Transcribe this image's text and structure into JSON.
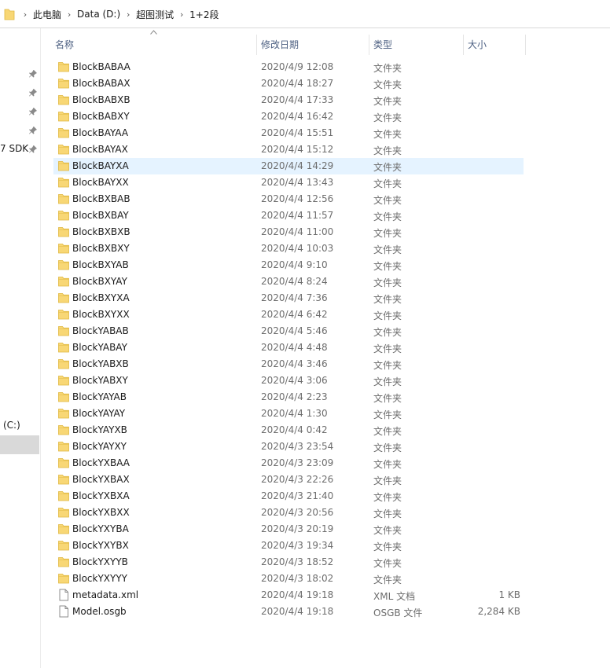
{
  "breadcrumb": [
    "此电脑",
    "Data (D:)",
    "超图测试",
    "1+2段"
  ],
  "nav": {
    "sdk_label": "7 SDK",
    "drive_label": "(C:)"
  },
  "columns": {
    "name": "名称",
    "date": "修改日期",
    "type": "类型",
    "size": "大小"
  },
  "selected_index": 6,
  "colors": {
    "folder": "#f8d775",
    "folder_dark": "#e0b840",
    "selection": "#e5f3ff",
    "header_text": "#4d6082"
  },
  "files": [
    {
      "name": "BlockBABAA",
      "date": "2020/4/9 12:08",
      "type": "文件夹",
      "size": "",
      "kind": "folder"
    },
    {
      "name": "BlockBABAX",
      "date": "2020/4/4 18:27",
      "type": "文件夹",
      "size": "",
      "kind": "folder"
    },
    {
      "name": "BlockBABXB",
      "date": "2020/4/4 17:33",
      "type": "文件夹",
      "size": "",
      "kind": "folder"
    },
    {
      "name": "BlockBABXY",
      "date": "2020/4/4 16:42",
      "type": "文件夹",
      "size": "",
      "kind": "folder"
    },
    {
      "name": "BlockBAYAA",
      "date": "2020/4/4 15:51",
      "type": "文件夹",
      "size": "",
      "kind": "folder"
    },
    {
      "name": "BlockBAYAX",
      "date": "2020/4/4 15:12",
      "type": "文件夹",
      "size": "",
      "kind": "folder"
    },
    {
      "name": "BlockBAYXA",
      "date": "2020/4/4 14:29",
      "type": "文件夹",
      "size": "",
      "kind": "folder"
    },
    {
      "name": "BlockBAYXX",
      "date": "2020/4/4 13:43",
      "type": "文件夹",
      "size": "",
      "kind": "folder"
    },
    {
      "name": "BlockBXBAB",
      "date": "2020/4/4 12:56",
      "type": "文件夹",
      "size": "",
      "kind": "folder"
    },
    {
      "name": "BlockBXBAY",
      "date": "2020/4/4 11:57",
      "type": "文件夹",
      "size": "",
      "kind": "folder"
    },
    {
      "name": "BlockBXBXB",
      "date": "2020/4/4 11:00",
      "type": "文件夹",
      "size": "",
      "kind": "folder"
    },
    {
      "name": "BlockBXBXY",
      "date": "2020/4/4 10:03",
      "type": "文件夹",
      "size": "",
      "kind": "folder"
    },
    {
      "name": "BlockBXYAB",
      "date": "2020/4/4 9:10",
      "type": "文件夹",
      "size": "",
      "kind": "folder"
    },
    {
      "name": "BlockBXYAY",
      "date": "2020/4/4 8:24",
      "type": "文件夹",
      "size": "",
      "kind": "folder"
    },
    {
      "name": "BlockBXYXA",
      "date": "2020/4/4 7:36",
      "type": "文件夹",
      "size": "",
      "kind": "folder"
    },
    {
      "name": "BlockBXYXX",
      "date": "2020/4/4 6:42",
      "type": "文件夹",
      "size": "",
      "kind": "folder"
    },
    {
      "name": "BlockYABAB",
      "date": "2020/4/4 5:46",
      "type": "文件夹",
      "size": "",
      "kind": "folder"
    },
    {
      "name": "BlockYABAY",
      "date": "2020/4/4 4:48",
      "type": "文件夹",
      "size": "",
      "kind": "folder"
    },
    {
      "name": "BlockYABXB",
      "date": "2020/4/4 3:46",
      "type": "文件夹",
      "size": "",
      "kind": "folder"
    },
    {
      "name": "BlockYABXY",
      "date": "2020/4/4 3:06",
      "type": "文件夹",
      "size": "",
      "kind": "folder"
    },
    {
      "name": "BlockYAYAB",
      "date": "2020/4/4 2:23",
      "type": "文件夹",
      "size": "",
      "kind": "folder"
    },
    {
      "name": "BlockYAYAY",
      "date": "2020/4/4 1:30",
      "type": "文件夹",
      "size": "",
      "kind": "folder"
    },
    {
      "name": "BlockYAYXB",
      "date": "2020/4/4 0:42",
      "type": "文件夹",
      "size": "",
      "kind": "folder"
    },
    {
      "name": "BlockYAYXY",
      "date": "2020/4/3 23:54",
      "type": "文件夹",
      "size": "",
      "kind": "folder"
    },
    {
      "name": "BlockYXBAA",
      "date": "2020/4/3 23:09",
      "type": "文件夹",
      "size": "",
      "kind": "folder"
    },
    {
      "name": "BlockYXBAX",
      "date": "2020/4/3 22:26",
      "type": "文件夹",
      "size": "",
      "kind": "folder"
    },
    {
      "name": "BlockYXBXA",
      "date": "2020/4/3 21:40",
      "type": "文件夹",
      "size": "",
      "kind": "folder"
    },
    {
      "name": "BlockYXBXX",
      "date": "2020/4/3 20:56",
      "type": "文件夹",
      "size": "",
      "kind": "folder"
    },
    {
      "name": "BlockYXYBA",
      "date": "2020/4/3 20:19",
      "type": "文件夹",
      "size": "",
      "kind": "folder"
    },
    {
      "name": "BlockYXYBX",
      "date": "2020/4/3 19:34",
      "type": "文件夹",
      "size": "",
      "kind": "folder"
    },
    {
      "name": "BlockYXYYB",
      "date": "2020/4/3 18:52",
      "type": "文件夹",
      "size": "",
      "kind": "folder"
    },
    {
      "name": "BlockYXYYY",
      "date": "2020/4/3 18:02",
      "type": "文件夹",
      "size": "",
      "kind": "folder"
    },
    {
      "name": "metadata.xml",
      "date": "2020/4/4 19:18",
      "type": "XML 文档",
      "size": "1 KB",
      "kind": "file"
    },
    {
      "name": "Model.osgb",
      "date": "2020/4/4 19:18",
      "type": "OSGB 文件",
      "size": "2,284 KB",
      "kind": "file"
    }
  ]
}
